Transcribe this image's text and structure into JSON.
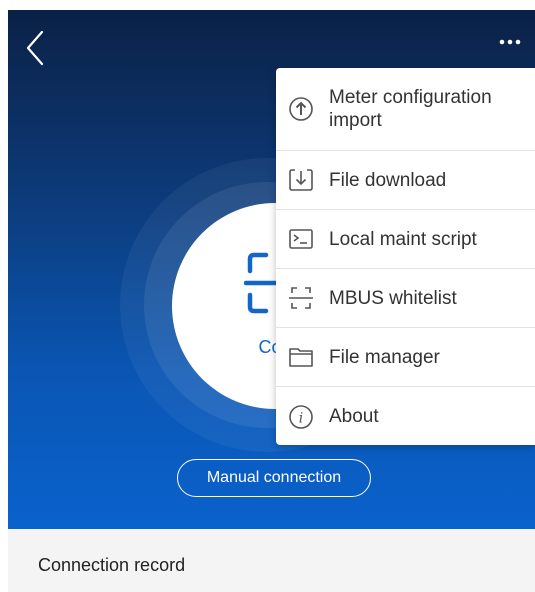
{
  "header": {
    "back_icon": "chevron-left-icon",
    "more_icon": "more-horizontal-icon"
  },
  "scan": {
    "icon": "scan-icon",
    "label": "Con"
  },
  "manual_connection_label": "Manual connection",
  "connection_record_label": "Connection record",
  "menu": {
    "items": [
      {
        "label": "Meter configuration import",
        "icon": "upload-circle-icon"
      },
      {
        "label": "File download",
        "icon": "download-icon"
      },
      {
        "label": "Local maint script",
        "icon": "terminal-icon"
      },
      {
        "label": "MBUS whitelist",
        "icon": "scan-frame-icon"
      },
      {
        "label": "File manager",
        "icon": "folder-icon"
      },
      {
        "label": "About",
        "icon": "info-icon"
      }
    ]
  },
  "colors": {
    "hero_top": "#0b2146",
    "hero_bottom": "#0a62cc",
    "accent": "#1266c9",
    "menu_icon": "#555555"
  }
}
